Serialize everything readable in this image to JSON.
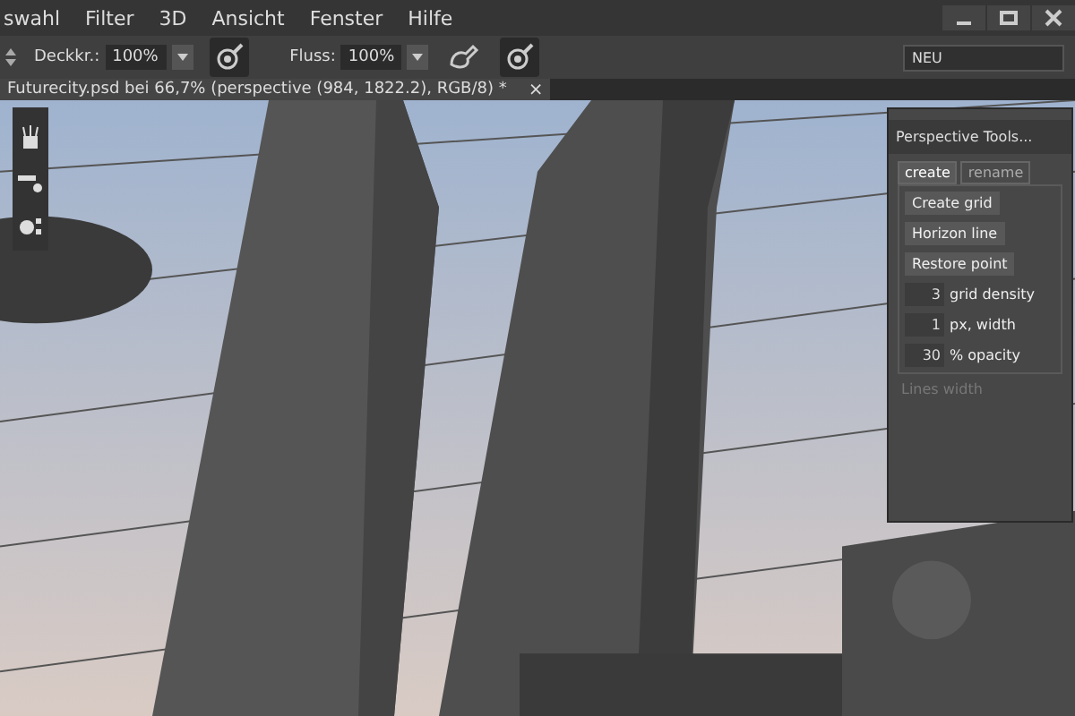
{
  "menu": [
    "swahl",
    "Filter",
    "3D",
    "Ansicht",
    "Fenster",
    "Hilfe"
  ],
  "options_bar": {
    "opacity": {
      "label": "Deckkr.:",
      "value": "100%"
    },
    "flow": {
      "label": "Fluss:",
      "value": "100%"
    },
    "workspace": "NEU"
  },
  "document_tab": {
    "title": "Futurecity.psd bei 66,7% (perspective (984, 1822.2), RGB/8) *",
    "close": "×"
  },
  "perspective_panel": {
    "title": "Perspective Tools...",
    "tabs": [
      {
        "label": "create",
        "selected": true
      },
      {
        "label": "rename",
        "selected": false
      }
    ],
    "buttons": [
      "Create grid",
      "Horizon line",
      "Restore point"
    ],
    "settings": [
      {
        "value": "3",
        "label": "grid density"
      },
      {
        "value": "1",
        "label": "px, width"
      },
      {
        "value": "30",
        "label": "% opacity"
      }
    ],
    "status": {
      "text": "Lines width",
      "disabled": true
    }
  }
}
